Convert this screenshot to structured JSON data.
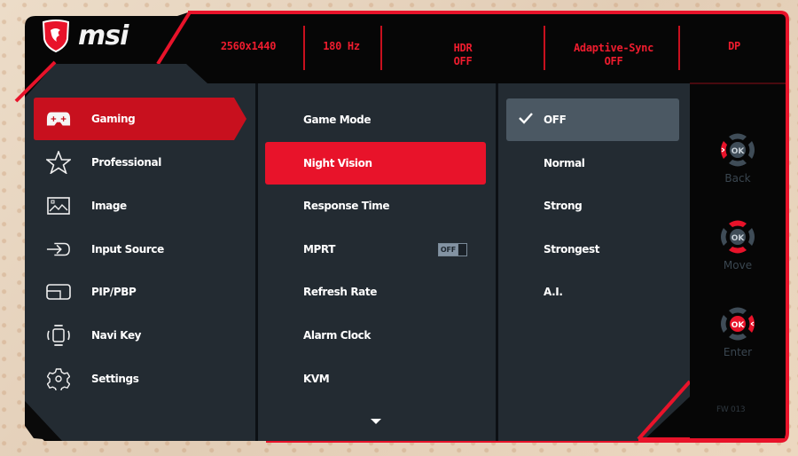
{
  "brand": {
    "logo_text": "msi",
    "accent": "#e8132a",
    "header_text_color": "#ee1c2e"
  },
  "status_bar": {
    "resolution": "2560x1440",
    "refresh": "180 Hz",
    "hdr": {
      "label": "HDR",
      "value": "OFF"
    },
    "adaptive_sync": {
      "label": "Adaptive-Sync",
      "value": "OFF"
    },
    "input": "DP"
  },
  "sidebar": {
    "items": [
      {
        "label": "Gaming",
        "icon": "gamepad-icon",
        "active": true
      },
      {
        "label": "Professional",
        "icon": "star-icon",
        "active": false
      },
      {
        "label": "Image",
        "icon": "image-icon",
        "active": false
      },
      {
        "label": "Input Source",
        "icon": "input-source-icon",
        "active": false
      },
      {
        "label": "PIP/PBP",
        "icon": "pip-icon",
        "active": false
      },
      {
        "label": "Navi Key",
        "icon": "navi-key-icon",
        "active": false
      },
      {
        "label": "Settings",
        "icon": "gear-icon",
        "active": false
      }
    ]
  },
  "submenu": {
    "items": [
      {
        "label": "Game Mode",
        "active": false
      },
      {
        "label": "Night Vision",
        "active": true
      },
      {
        "label": "Response Time",
        "active": false
      },
      {
        "label": "MPRT",
        "active": false,
        "toggle": "OFF"
      },
      {
        "label": "Refresh Rate",
        "active": false
      },
      {
        "label": "Alarm Clock",
        "active": false
      },
      {
        "label": "KVM",
        "active": false
      }
    ],
    "more_below_icon": "chevron-down-icon"
  },
  "options": {
    "items": [
      {
        "label": "OFF",
        "selected": true
      },
      {
        "label": "Normal",
        "selected": false
      },
      {
        "label": "Strong",
        "selected": false
      },
      {
        "label": "Strongest",
        "selected": false
      },
      {
        "label": "A.I.",
        "selected": false
      }
    ]
  },
  "navigation_hints": [
    {
      "label": "Back",
      "key": "OK",
      "highlight": "left"
    },
    {
      "label": "Move",
      "key": "OK",
      "highlight": "up-down"
    },
    {
      "label": "Enter",
      "key": "OK",
      "highlight": "ok-right"
    }
  ],
  "firmware": "FW 013"
}
